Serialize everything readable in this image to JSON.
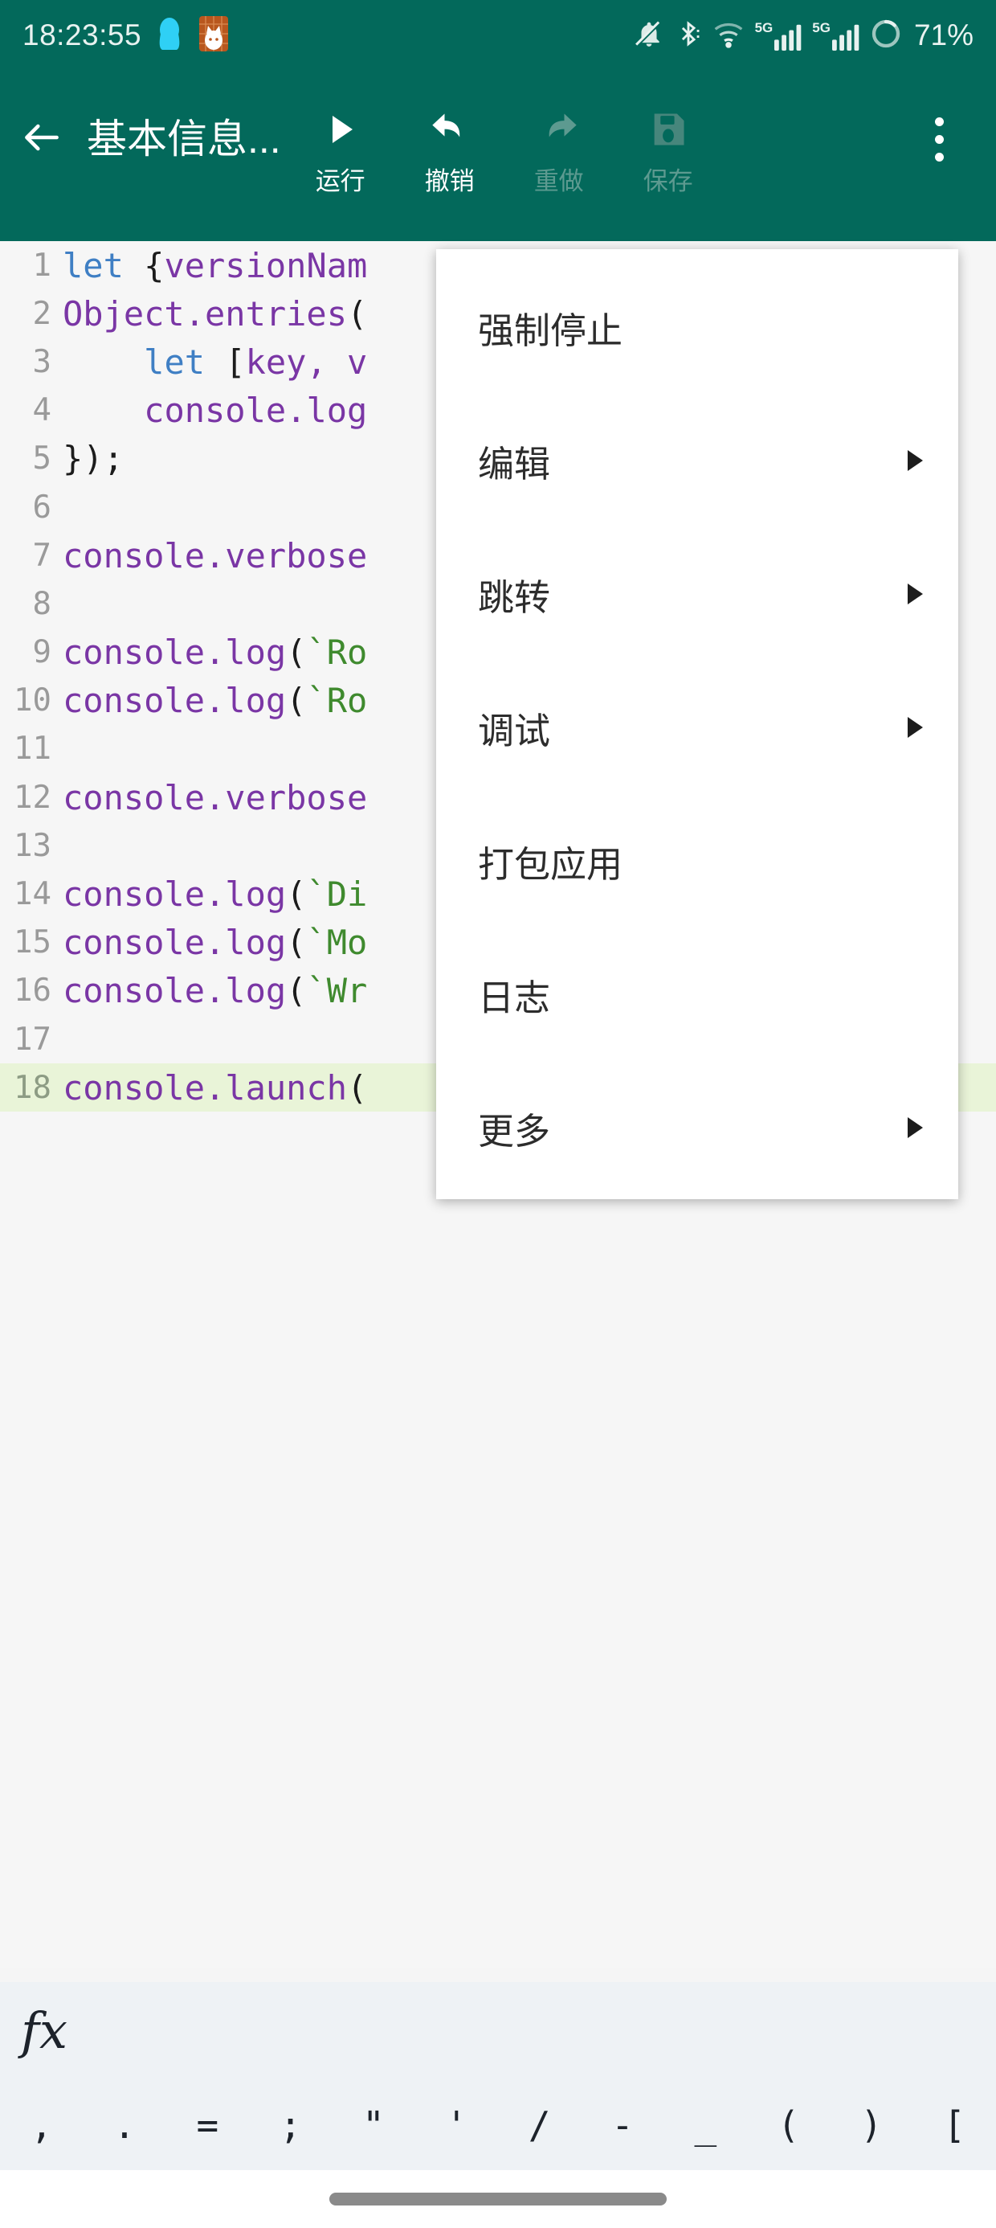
{
  "status_bar": {
    "clock": "18:23:55",
    "battery_percent": "71%",
    "left_icons": [
      "qq-penguin-icon",
      "app-notification-icon"
    ],
    "right_icons": [
      "bell-mute-icon",
      "bluetooth-icon",
      "wifi-icon",
      "signal-5g-icon-1",
      "signal-5g-icon-2",
      "battery-icon"
    ],
    "network_label_1": "5G",
    "network_label_2": "5G"
  },
  "toolbar": {
    "back_icon": "back-arrow-icon",
    "title": "基本信息...",
    "overflow_icon": "overflow-menu-icon",
    "actions": [
      {
        "label": "运行",
        "icon": "play-icon",
        "enabled": true
      },
      {
        "label": "撤销",
        "icon": "undo-icon",
        "enabled": true
      },
      {
        "label": "重做",
        "icon": "redo-icon",
        "enabled": false
      },
      {
        "label": "保存",
        "icon": "save-icon",
        "enabled": false
      }
    ]
  },
  "menu": {
    "items": [
      {
        "label": "强制停止",
        "has_submenu": false
      },
      {
        "label": "编辑",
        "has_submenu": true
      },
      {
        "label": "跳转",
        "has_submenu": true
      },
      {
        "label": "调试",
        "has_submenu": true
      },
      {
        "label": "打包应用",
        "has_submenu": false
      },
      {
        "label": "日志",
        "has_submenu": false
      },
      {
        "label": "更多",
        "has_submenu": true
      }
    ]
  },
  "editor": {
    "current_line": 18,
    "lines": [
      {
        "n": "1",
        "text": "let {versionNam"
      },
      {
        "n": "2",
        "text": "Object.entries("
      },
      {
        "n": "3",
        "text": "    let [key, v"
      },
      {
        "n": "4",
        "text": "    console.log"
      },
      {
        "n": "5",
        "text": "});"
      },
      {
        "n": "6",
        "text": ""
      },
      {
        "n": "7",
        "text": "console.verbose"
      },
      {
        "n": "8",
        "text": ""
      },
      {
        "n": "9",
        "text": "console.log(`Ro"
      },
      {
        "n": "10",
        "text": "console.log(`Ro"
      },
      {
        "n": "11",
        "text": ""
      },
      {
        "n": "12",
        "text": "console.verbose"
      },
      {
        "n": "13",
        "text": ""
      },
      {
        "n": "14",
        "text": "console.log(`Di"
      },
      {
        "n": "15",
        "text": "console.log(`Mo"
      },
      {
        "n": "16",
        "text": "console.log(`Wr"
      },
      {
        "n": "17",
        "text": ""
      },
      {
        "n": "18",
        "text": "console.launch("
      }
    ]
  },
  "bottom_bar": {
    "fx_label": "fx",
    "symbols": [
      ",",
      ".",
      "=",
      ";",
      "\"",
      "'",
      "/",
      "-",
      "_",
      "(",
      ")",
      "["
    ]
  },
  "colors": {
    "toolbar": "#03695B",
    "editor_bg": "#f6f6f6",
    "current_line": "#e9f4d8",
    "menu_bg": "#ffffff",
    "bottom_bar": "#eef2f5",
    "keyword": "#3f7fc4",
    "identifier": "#7a36a5",
    "string": "#3f8a2e"
  }
}
